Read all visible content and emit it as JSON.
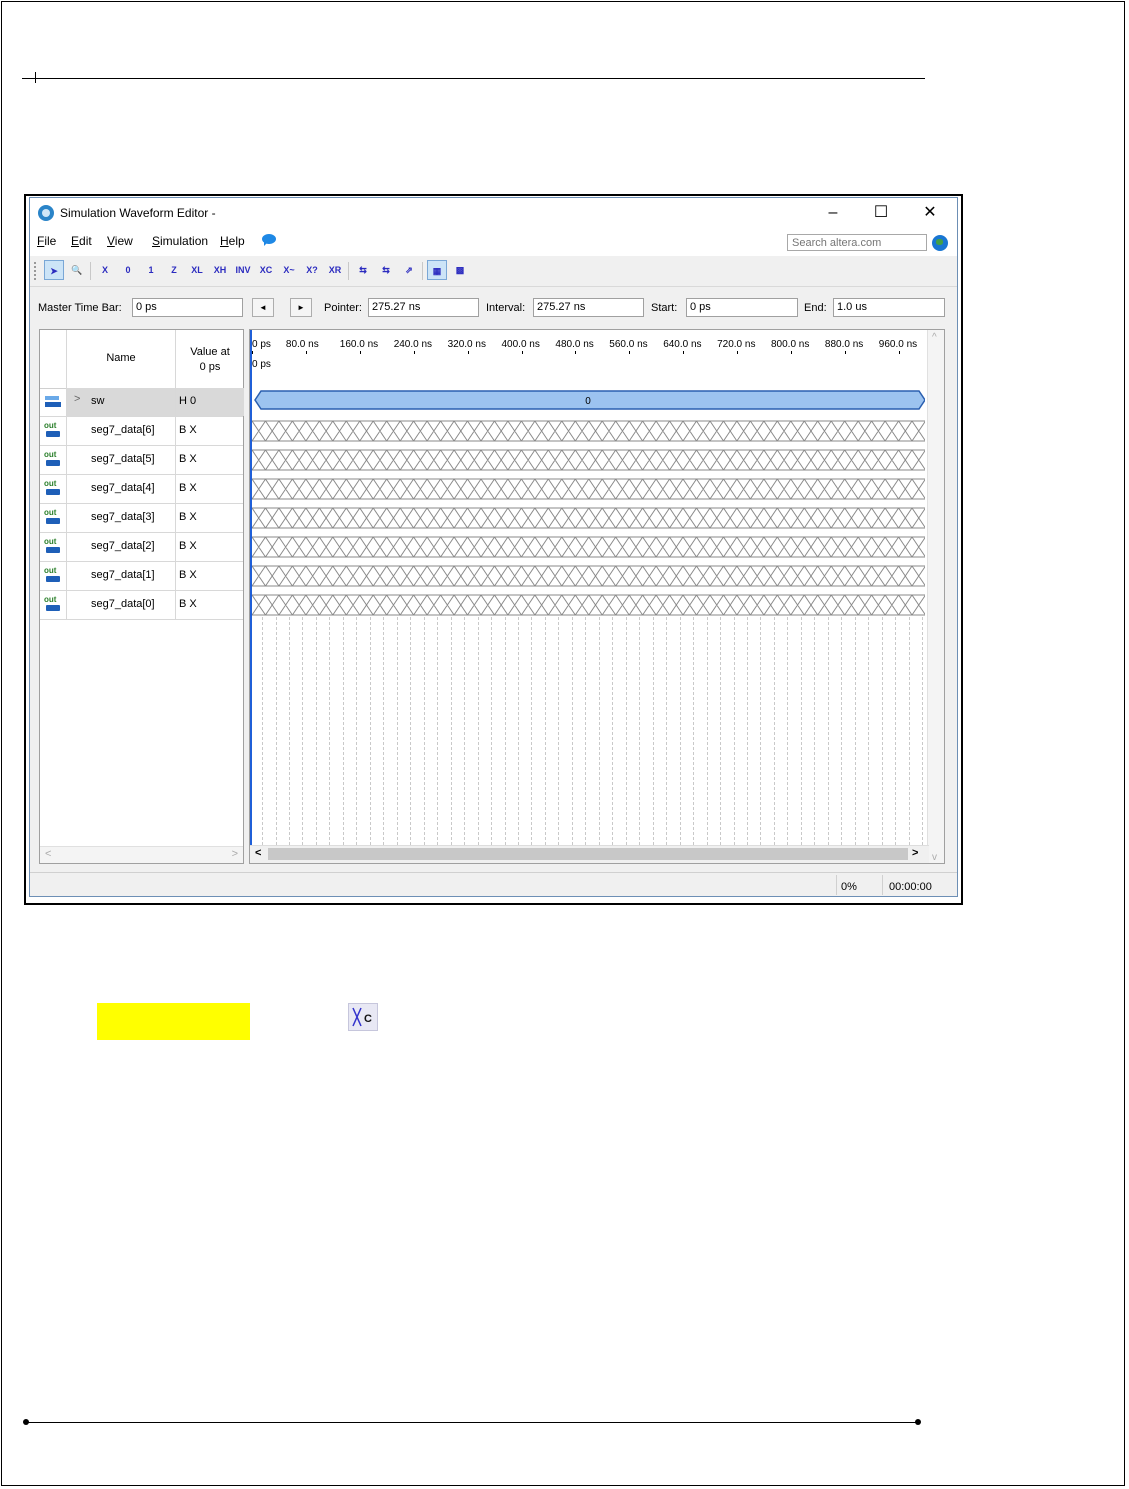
{
  "window": {
    "title": "Simulation Waveform Editor -",
    "controls": [
      "–",
      "☐",
      "✕"
    ]
  },
  "menu": {
    "items": [
      {
        "label": "File",
        "underline": "F",
        "rest": "ile"
      },
      {
        "label": "Edit",
        "underline": "E",
        "rest": "dit"
      },
      {
        "label": "View",
        "underline": "V",
        "rest": "iew"
      },
      {
        "label": "Simulation",
        "underline": "S",
        "rest": "imulation"
      },
      {
        "label": "Help",
        "underline": "H",
        "rest": "elp"
      }
    ],
    "search_placeholder": "Search altera.com"
  },
  "toolbar": {
    "buttons": [
      {
        "name": "selection-tool-icon",
        "glyph": "➤",
        "selected": true
      },
      {
        "name": "zoom-tool-icon",
        "glyph": "🔍"
      },
      {
        "name": "force-unknown-icon",
        "glyph": "X"
      },
      {
        "name": "force-low-icon",
        "glyph": "0"
      },
      {
        "name": "force-high-icon",
        "glyph": "1"
      },
      {
        "name": "force-high-impedance-icon",
        "glyph": "Z"
      },
      {
        "name": "force-weak-low-icon",
        "glyph": "XL"
      },
      {
        "name": "force-weak-high-icon",
        "glyph": "XH"
      },
      {
        "name": "invert-icon",
        "glyph": "INV"
      },
      {
        "name": "count-value-icon",
        "glyph": "XC"
      },
      {
        "name": "overwrite-clock-icon",
        "glyph": "X~"
      },
      {
        "name": "arbitrary-value-icon",
        "glyph": "X?"
      },
      {
        "name": "random-value-icon",
        "glyph": "XR"
      },
      {
        "name": "snap-to-grid-icon",
        "glyph": "⇆"
      },
      {
        "name": "functional-simulation-icon",
        "glyph": "⇆"
      },
      {
        "name": "timing-simulation-icon",
        "glyph": "⇗"
      },
      {
        "name": "netlist-view-icon",
        "glyph": "▦",
        "selected": true
      },
      {
        "name": "grid-settings-icon",
        "glyph": "▩"
      }
    ]
  },
  "timebar": {
    "master_time_bar_label": "Master Time Bar:",
    "master_time_bar_value": "0 ps",
    "prev_glyph": "◄",
    "next_glyph": "►",
    "pointer_label": "Pointer:",
    "pointer_value": "275.27 ns",
    "interval_label": "Interval:",
    "interval_value": "275.27 ns",
    "start_label": "Start:",
    "start_value": "0 ps",
    "end_label": "End:",
    "end_value": "1.0 us"
  },
  "signals": {
    "col_name": "Name",
    "col_value_line1": "Value at",
    "col_value_line2": "0 ps",
    "rows": [
      {
        "name": "sw",
        "value": "H 0",
        "type": "input",
        "expandable": true
      },
      {
        "name": "seg7_data[6]",
        "value": "B X",
        "type": "output"
      },
      {
        "name": "seg7_data[5]",
        "value": "B X",
        "type": "output"
      },
      {
        "name": "seg7_data[4]",
        "value": "B X",
        "type": "output"
      },
      {
        "name": "seg7_data[3]",
        "value": "B X",
        "type": "output"
      },
      {
        "name": "seg7_data[2]",
        "value": "B X",
        "type": "output"
      },
      {
        "name": "seg7_data[1]",
        "value": "B X",
        "type": "output"
      },
      {
        "name": "seg7_data[0]",
        "value": "B X",
        "type": "output"
      }
    ],
    "out_icon_text": "out",
    "expand_glyph": ">"
  },
  "waveform": {
    "ruler": [
      "0 ps",
      "80.0 ns",
      "160.0 ns",
      "240.0 ns",
      "320.0 ns",
      "400.0 ns",
      "480.0 ns",
      "560.0 ns",
      "640.0 ns",
      "720.0 ns",
      "800.0 ns",
      "880.0 ns",
      "960.0 ns"
    ],
    "cursor_label": "0 ps",
    "bus_value": "0",
    "bus_fill": "#9cc3f0",
    "bus_stroke": "#2a5fb0",
    "x_pattern_color": "#8a8a8a",
    "cursor_color": "#1f5fd8"
  },
  "scroll": {
    "left": "<",
    "right": ">",
    "up": "^",
    "down": "v"
  },
  "status": {
    "progress": "0%",
    "elapsed": "00:00:00"
  },
  "below": {
    "highlight_color": "#ffff00",
    "icon_glyph": "XC"
  }
}
